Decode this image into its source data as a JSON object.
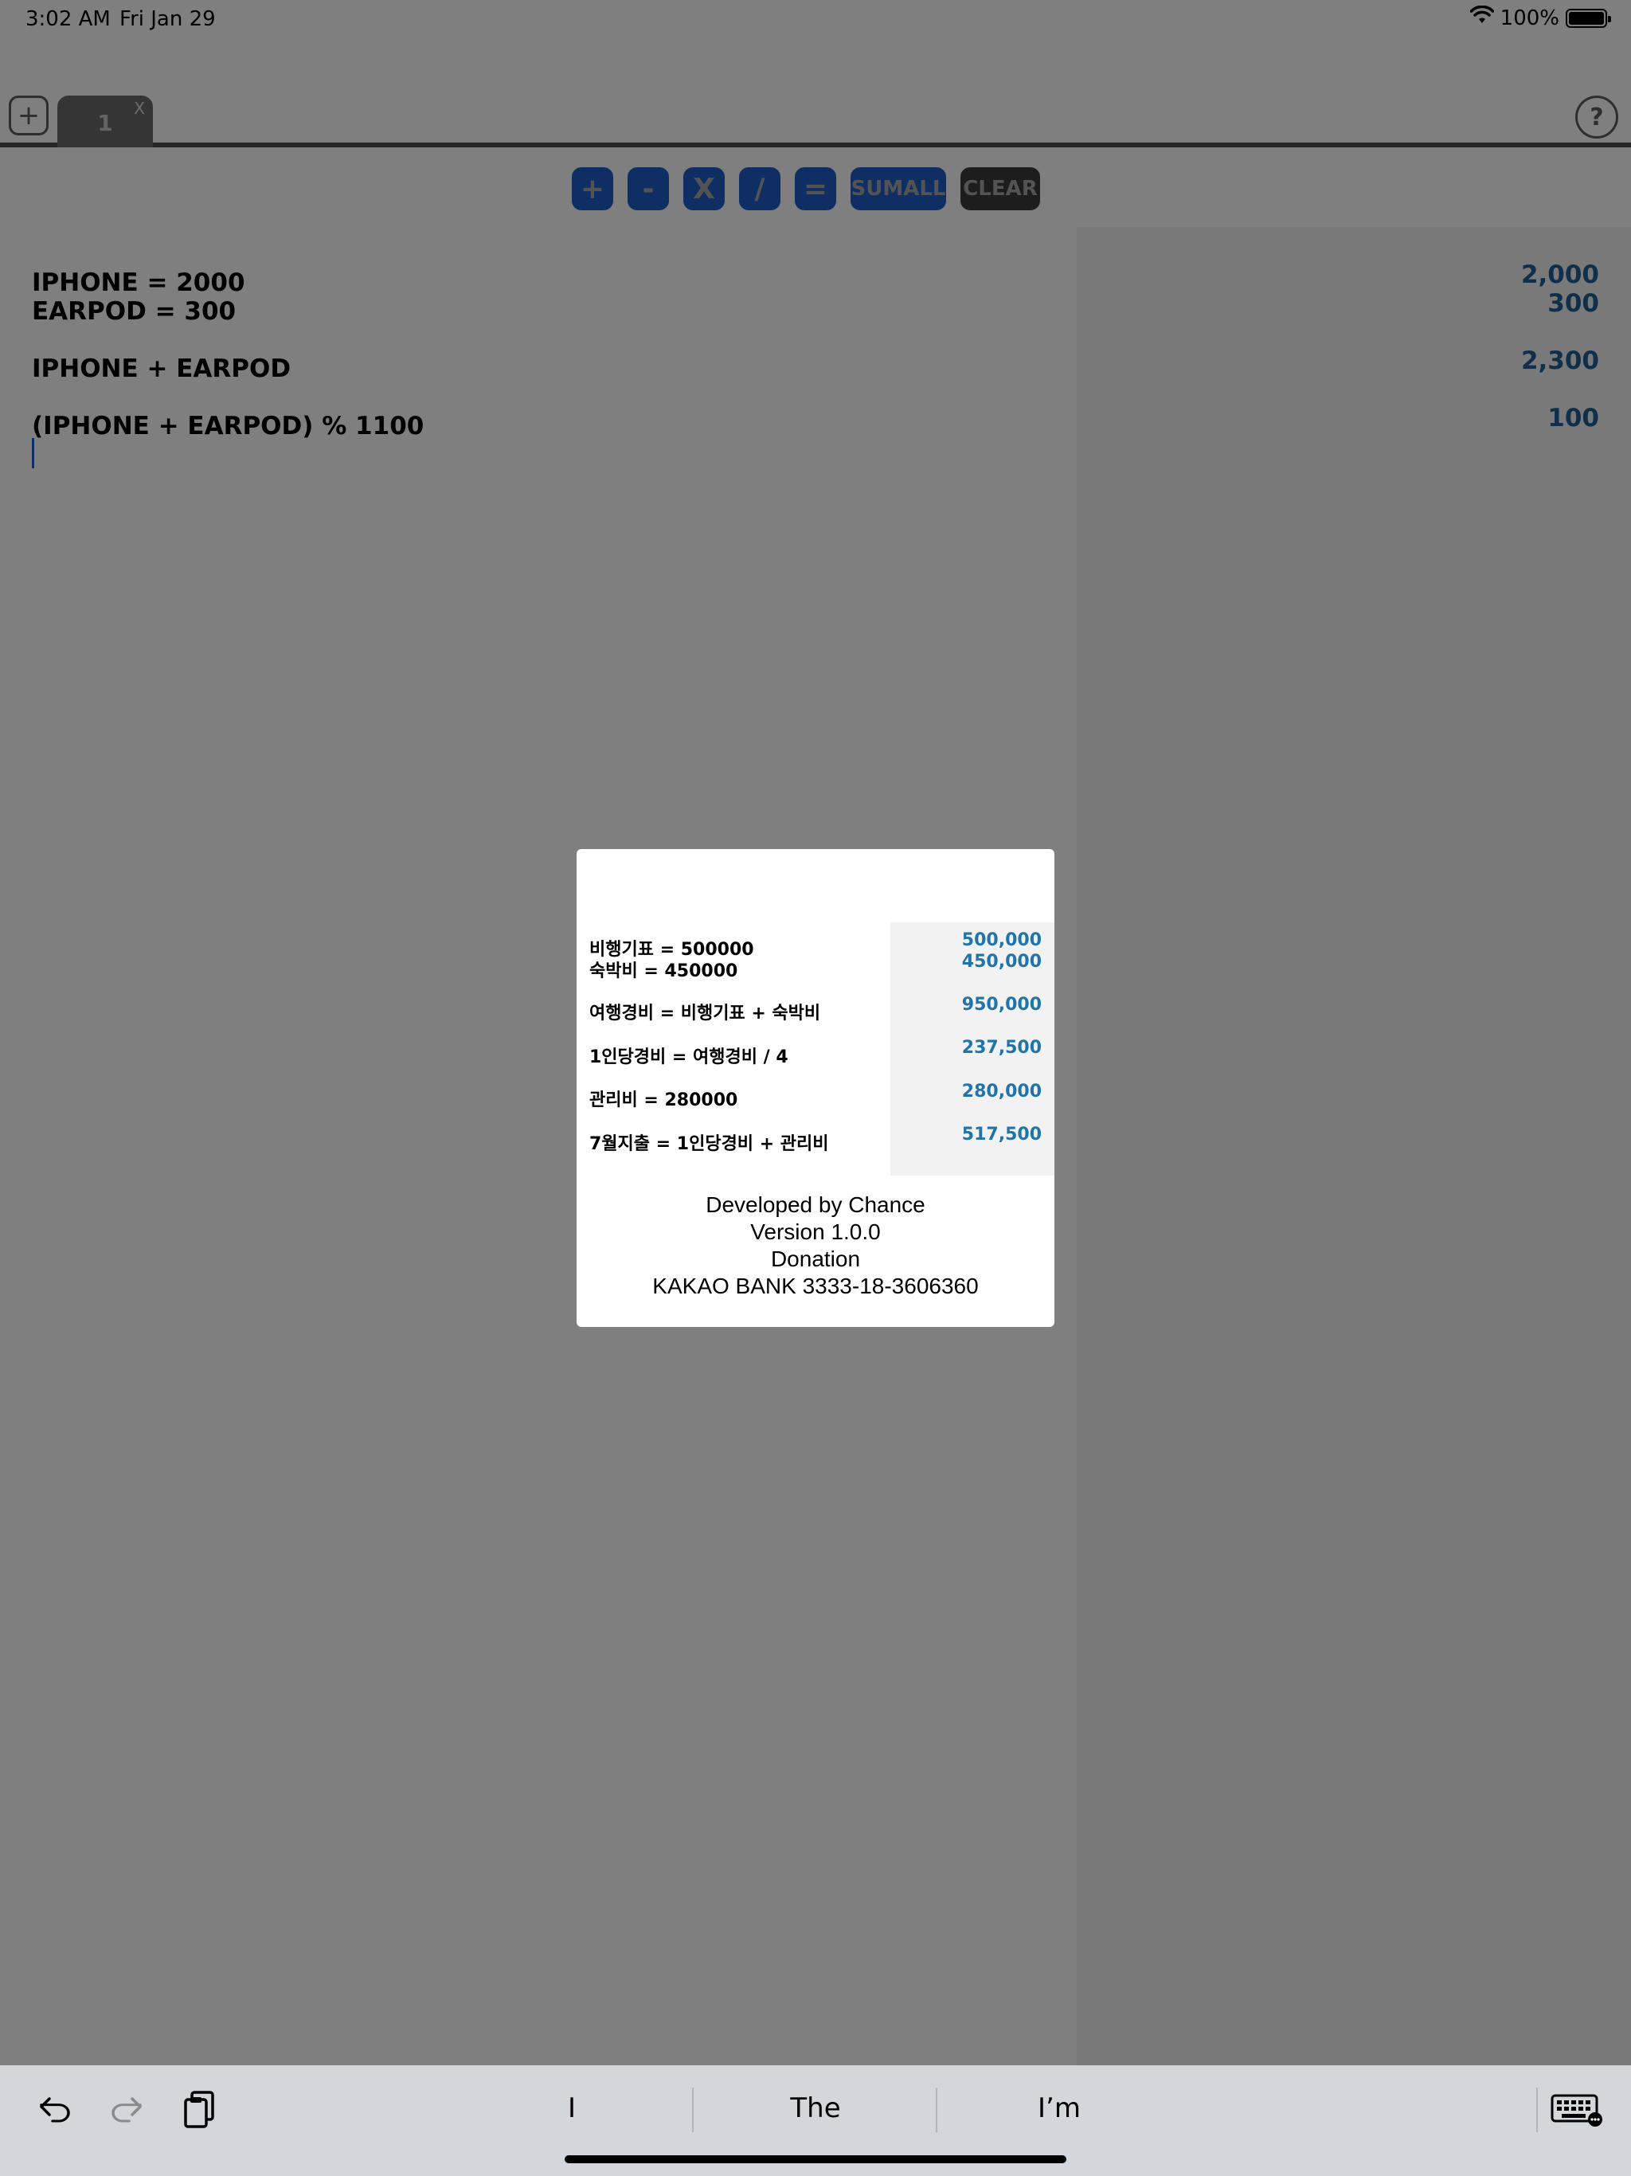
{
  "status_bar": {
    "time": "3:02 AM",
    "date": "Fri Jan 29",
    "battery_text": "100%"
  },
  "tabs": {
    "add_label": "+",
    "items": [
      {
        "label": "1",
        "close": "X"
      }
    ],
    "help_label": "?"
  },
  "toolbar": {
    "plus": "+",
    "minus": "-",
    "multiply": "X",
    "divide": "/",
    "equals": "=",
    "sumall": "SUMALL",
    "clear": "CLEAR"
  },
  "editor": {
    "lines": [
      "IPHONE = 2000",
      "EARPOD = 300",
      "IPHONE + EARPOD",
      "(IPHONE + EARPOD) % 1100"
    ]
  },
  "results": {
    "lines": [
      "2,000",
      "300",
      "2,300",
      "100"
    ]
  },
  "about_modal": {
    "example_lines": [
      "비행기표 = 500000",
      "숙박비 = 450000",
      "여행경비 = 비행기표 + 숙박비",
      "1인당경비 = 여행경비 / 4",
      "관리비 = 280000",
      "7월지출 = 1인당경비 + 관리비"
    ],
    "example_results": [
      "500,000",
      "450,000",
      "950,000",
      "237,500",
      "280,000",
      "517,500"
    ],
    "developer": "Developed by Chance",
    "version": "Version 1.0.0",
    "donation": "Donation",
    "bank": "KAKAO BANK 3333-18-3606360"
  },
  "keyboard_bar": {
    "suggestions": [
      "I",
      "The",
      "I’m"
    ]
  },
  "colors": {
    "button_blue": "#1f5fc8",
    "result_blue": "#1e5f96",
    "clear_dark": "#3a3a3a",
    "overlay": "rgba(0,0,0,0.5)"
  },
  "icons": [
    "wifi-icon",
    "battery-icon",
    "undo-icon",
    "redo-icon",
    "clipboard-icon",
    "keyboard-dismiss-icon"
  ]
}
